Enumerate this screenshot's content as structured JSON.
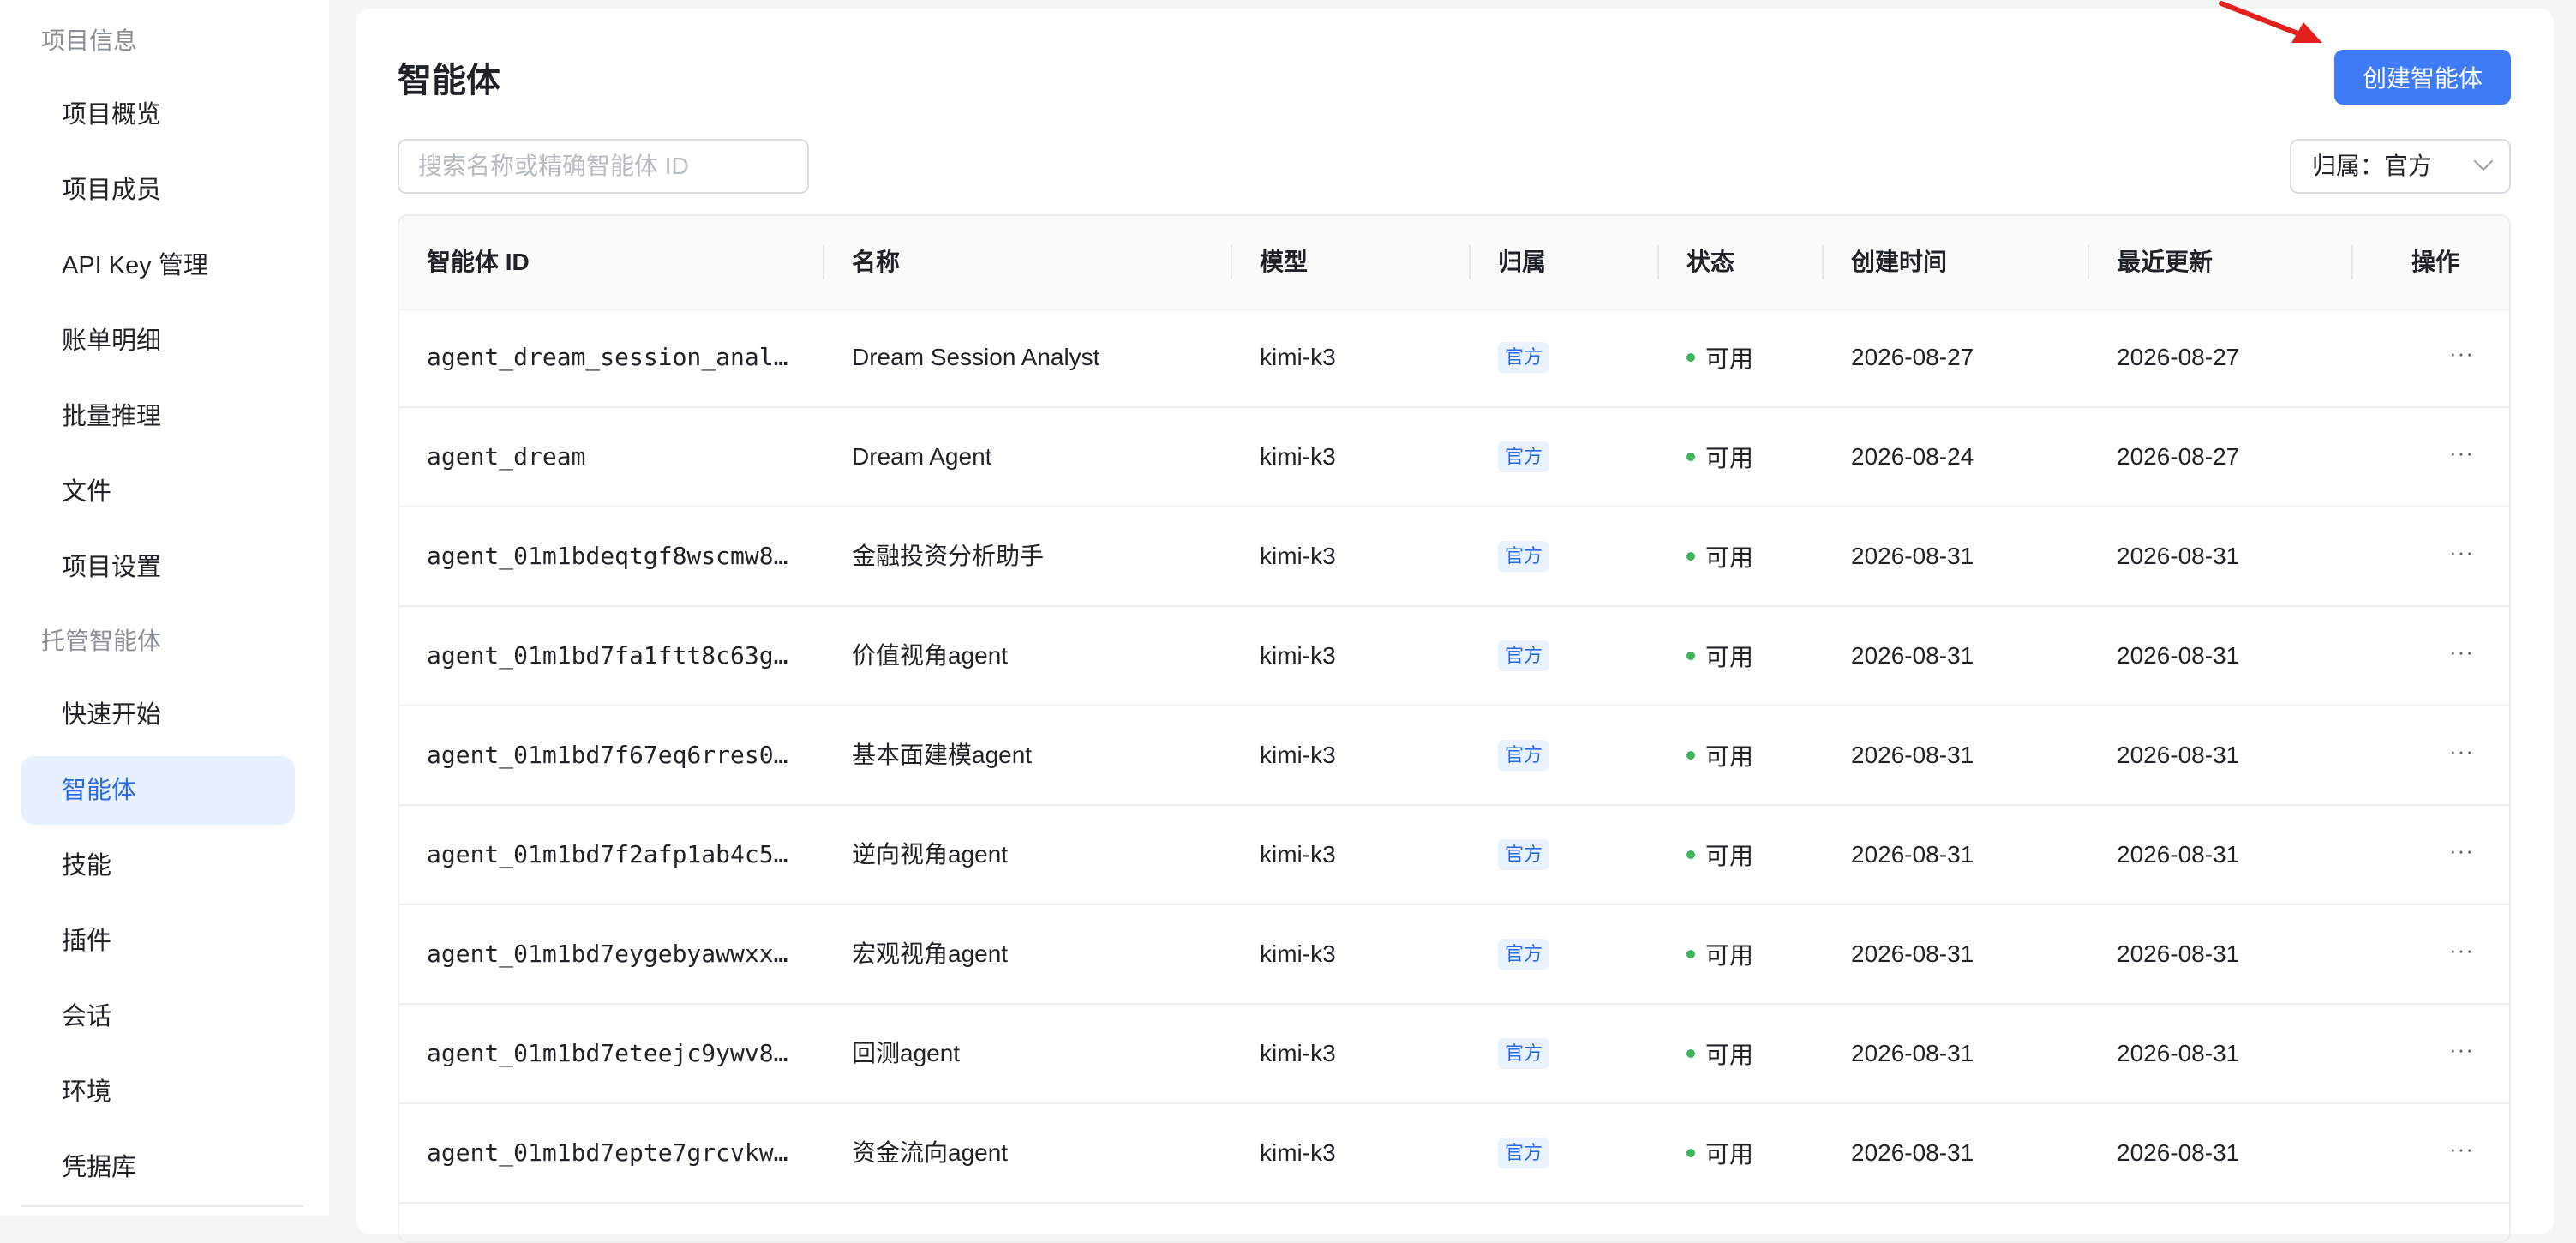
{
  "sidebar": {
    "groups": [
      {
        "label": "项目信息"
      },
      {
        "label": "托管智能体"
      }
    ],
    "items": [
      {
        "label": "项目概览"
      },
      {
        "label": "项目成员"
      },
      {
        "label": "API Key 管理"
      },
      {
        "label": "账单明细"
      },
      {
        "label": "批量推理"
      },
      {
        "label": "文件"
      },
      {
        "label": "项目设置"
      },
      {
        "label": "快速开始"
      },
      {
        "label": "智能体"
      },
      {
        "label": "技能"
      },
      {
        "label": "插件"
      },
      {
        "label": "会话"
      },
      {
        "label": "环境"
      },
      {
        "label": "凭据库"
      }
    ],
    "active_item": "智能体"
  },
  "header": {
    "title": "智能体",
    "create_button": "创建智能体"
  },
  "search": {
    "placeholder": "搜索名称或精确智能体 ID",
    "value": ""
  },
  "filter": {
    "label": "归属：官方"
  },
  "table": {
    "columns": [
      "智能体 ID",
      "名称",
      "模型",
      "归属",
      "状态",
      "创建时间",
      "最近更新",
      "操作"
    ],
    "rows": [
      {
        "id": "agent_dream_session_anal…",
        "name": "Dream Session Analyst",
        "model": "kimi-k3",
        "owner": "官方",
        "status": "可用",
        "created": "2026-08-27",
        "updated": "2026-08-27",
        "actions": "···"
      },
      {
        "id": "agent_dream",
        "name": "Dream Agent",
        "model": "kimi-k3",
        "owner": "官方",
        "status": "可用",
        "created": "2026-08-24",
        "updated": "2026-08-27",
        "actions": "···"
      },
      {
        "id": "agent_01m1bdeqtgf8wscmw8…",
        "name": "金融投资分析助手",
        "model": "kimi-k3",
        "owner": "官方",
        "status": "可用",
        "created": "2026-08-31",
        "updated": "2026-08-31",
        "actions": "···"
      },
      {
        "id": "agent_01m1bd7fa1ftt8c63g…",
        "name": "价值视角agent",
        "model": "kimi-k3",
        "owner": "官方",
        "status": "可用",
        "created": "2026-08-31",
        "updated": "2026-08-31",
        "actions": "···"
      },
      {
        "id": "agent_01m1bd7f67eq6rres0…",
        "name": "基本面建模agent",
        "model": "kimi-k3",
        "owner": "官方",
        "status": "可用",
        "created": "2026-08-31",
        "updated": "2026-08-31",
        "actions": "···"
      },
      {
        "id": "agent_01m1bd7f2afp1ab4c5…",
        "name": "逆向视角agent",
        "model": "kimi-k3",
        "owner": "官方",
        "status": "可用",
        "created": "2026-08-31",
        "updated": "2026-08-31",
        "actions": "···"
      },
      {
        "id": "agent_01m1bd7eygebyawwxx…",
        "name": "宏观视角agent",
        "model": "kimi-k3",
        "owner": "官方",
        "status": "可用",
        "created": "2026-08-31",
        "updated": "2026-08-31",
        "actions": "···"
      },
      {
        "id": "agent_01m1bd7eteejc9ywv8…",
        "name": "回测agent",
        "model": "kimi-k3",
        "owner": "官方",
        "status": "可用",
        "created": "2026-08-31",
        "updated": "2026-08-31",
        "actions": "···"
      },
      {
        "id": "agent_01m1bd7epte7grcvkw…",
        "name": "资金流向agent",
        "model": "kimi-k3",
        "owner": "官方",
        "status": "可用",
        "created": "2026-08-31",
        "updated": "2026-08-31",
        "actions": "···"
      }
    ]
  },
  "colors": {
    "accent": "#3f7bf6",
    "status_ok": "#3bb55a",
    "tag_bg": "#eaf2ff",
    "annotation_arrow": "#e3201b"
  },
  "icons": {
    "filter_dropdown": "chevron-down-icon",
    "row_actions": "more-icon",
    "annotation": "red-arrow-icon"
  }
}
